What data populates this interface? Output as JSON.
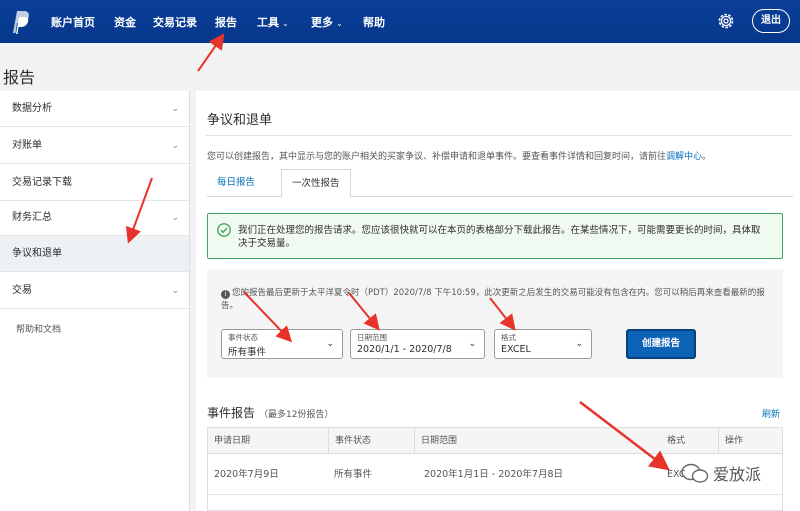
{
  "nav": {
    "items": [
      {
        "label": "账户首页"
      },
      {
        "label": "资金"
      },
      {
        "label": "交易记录"
      },
      {
        "label": "报告"
      },
      {
        "label": "工具"
      },
      {
        "label": "更多"
      },
      {
        "label": "帮助"
      }
    ],
    "logout": "退出",
    "icons": [
      "paypal-logo",
      "gear-icon"
    ]
  },
  "page_title": "报告",
  "sidebar": {
    "items": [
      {
        "label": "数据分析",
        "expandable": true
      },
      {
        "label": "对账单",
        "expandable": true
      },
      {
        "label": "交易记录下载",
        "expandable": false
      },
      {
        "label": "财务汇总",
        "expandable": true
      },
      {
        "label": "争议和退单",
        "expandable": false,
        "active": true
      },
      {
        "label": "交易",
        "expandable": true
      }
    ],
    "help": "帮助和文档"
  },
  "main": {
    "title": "争议和退单",
    "description": "您可以创建报告，其中显示与您的账户相关的买家争议、补偿申请和退单事件。要查看事件详情和回复时间，请前往",
    "description_link": "调解中心",
    "description_end": "。",
    "tabs": [
      {
        "label": "每日报告",
        "active": false
      },
      {
        "label": "一次性报告",
        "active": true
      }
    ],
    "alert": "我们正在处理您的报告请求。您应该很快就可以在本页的表格部分下载此报告。在某些情况下，可能需要更长的时间，具体取决于交易量。",
    "info": "您的报告最后更新于太平洋夏令时（PDT）2020/7/8 下午10:59，此次更新之后发生的交易可能没有包含在内。您可以稍后再来查看最新的报告。",
    "filters": {
      "event_status": {
        "label": "事件状态",
        "value": "所有事件"
      },
      "date_range": {
        "label": "日期范围",
        "value": "2020/1/1 - 2020/7/8"
      },
      "format": {
        "label": "格式",
        "value": "EXCEL"
      }
    },
    "create_button": "创建报告",
    "reports": {
      "title": "事件报告",
      "subtitle": "（最多12份报告）",
      "refresh": "刷新",
      "columns": [
        "申请日期",
        "事件状态",
        "日期范围",
        "格式",
        "操作"
      ],
      "rows": [
        [
          "2020年7月9日",
          "所有事件",
          "2020年1月1日 - 2020年7月8日",
          "EXC",
          ""
        ]
      ]
    }
  },
  "watermark": "爱放派",
  "colors": {
    "nav_bg": "#06378a",
    "link": "#0070ba",
    "alert_border": "#3ca55c",
    "button": "#0d63b6",
    "annotation_arrow": "#e8332a"
  }
}
